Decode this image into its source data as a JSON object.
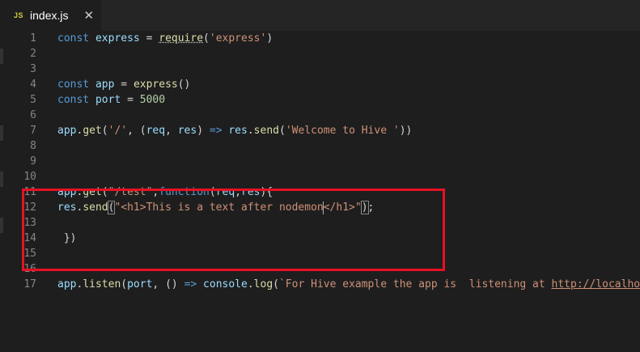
{
  "tab": {
    "icon_text": "JS",
    "filename": "index.js",
    "close_glyph": "✕"
  },
  "editor": {
    "lines": [
      {
        "number": "1",
        "tokens": [
          {
            "t": "const ",
            "c": "kw"
          },
          {
            "t": "express",
            "c": "var"
          },
          {
            "t": " = ",
            "c": ""
          },
          {
            "t": "require",
            "c": "fn squiggle"
          },
          {
            "t": "(",
            "c": ""
          },
          {
            "t": "'express'",
            "c": "str"
          },
          {
            "t": ")",
            "c": ""
          }
        ]
      },
      {
        "number": "2",
        "tokens": []
      },
      {
        "number": "3",
        "tokens": []
      },
      {
        "number": "4",
        "tokens": [
          {
            "t": "const ",
            "c": "kw"
          },
          {
            "t": "app",
            "c": "var"
          },
          {
            "t": " = ",
            "c": ""
          },
          {
            "t": "express",
            "c": "fn"
          },
          {
            "t": "()",
            "c": ""
          }
        ]
      },
      {
        "number": "5",
        "tokens": [
          {
            "t": "const ",
            "c": "kw"
          },
          {
            "t": "port",
            "c": "var"
          },
          {
            "t": " = ",
            "c": ""
          },
          {
            "t": "5000",
            "c": "num"
          }
        ]
      },
      {
        "number": "6",
        "tokens": []
      },
      {
        "number": "7",
        "tokens": [
          {
            "t": "app",
            "c": "var"
          },
          {
            "t": ".",
            "c": ""
          },
          {
            "t": "get",
            "c": "fn"
          },
          {
            "t": "(",
            "c": ""
          },
          {
            "t": "'/'",
            "c": "str"
          },
          {
            "t": ", (",
            "c": ""
          },
          {
            "t": "req",
            "c": "var"
          },
          {
            "t": ", ",
            "c": ""
          },
          {
            "t": "res",
            "c": "var"
          },
          {
            "t": ") ",
            "c": ""
          },
          {
            "t": "=>",
            "c": "kw"
          },
          {
            "t": " ",
            "c": ""
          },
          {
            "t": "res",
            "c": "var"
          },
          {
            "t": ".",
            "c": ""
          },
          {
            "t": "send",
            "c": "fn"
          },
          {
            "t": "(",
            "c": ""
          },
          {
            "t": "'Welcome to Hive '",
            "c": "str"
          },
          {
            "t": "))",
            "c": ""
          }
        ]
      },
      {
        "number": "8",
        "tokens": []
      },
      {
        "number": "9",
        "tokens": []
      },
      {
        "number": "10",
        "tokens": []
      },
      {
        "number": "11",
        "tokens": [
          {
            "t": "app",
            "c": "var"
          },
          {
            "t": ".",
            "c": ""
          },
          {
            "t": "get",
            "c": "fn"
          },
          {
            "t": "(",
            "c": ""
          },
          {
            "t": "\"/test\"",
            "c": "str"
          },
          {
            "t": ",",
            "c": ""
          },
          {
            "t": "function",
            "c": "kw"
          },
          {
            "t": "(",
            "c": ""
          },
          {
            "t": "req",
            "c": "var"
          },
          {
            "t": ",",
            "c": ""
          },
          {
            "t": "res",
            "c": "var"
          },
          {
            "t": "){",
            "c": ""
          }
        ]
      },
      {
        "number": "12",
        "tokens": [
          {
            "t": "res",
            "c": "var"
          },
          {
            "t": ".",
            "c": ""
          },
          {
            "t": "send",
            "c": "fn"
          },
          {
            "t": "(",
            "c": "bracket-match"
          },
          {
            "t": "\"<h1>This is a text after nodemon",
            "c": "str"
          },
          {
            "t": "",
            "c": "cursor"
          },
          {
            "t": "</h1>\"",
            "c": "str"
          },
          {
            "t": ")",
            "c": "bracket-match"
          },
          {
            "t": ";",
            "c": ""
          }
        ]
      },
      {
        "number": "13",
        "tokens": []
      },
      {
        "number": "14",
        "tokens": [
          {
            "t": " })",
            "c": ""
          }
        ]
      },
      {
        "number": "15",
        "tokens": []
      },
      {
        "number": "16",
        "tokens": []
      },
      {
        "number": "17",
        "tokens": [
          {
            "t": "app",
            "c": "var"
          },
          {
            "t": ".",
            "c": ""
          },
          {
            "t": "listen",
            "c": "fn"
          },
          {
            "t": "(",
            "c": ""
          },
          {
            "t": "port",
            "c": "var"
          },
          {
            "t": ", () ",
            "c": ""
          },
          {
            "t": "=>",
            "c": "kw"
          },
          {
            "t": " ",
            "c": ""
          },
          {
            "t": "console",
            "c": "var"
          },
          {
            "t": ".",
            "c": ""
          },
          {
            "t": "log",
            "c": "fn"
          },
          {
            "t": "(",
            "c": ""
          },
          {
            "t": "`For Hive example the app is  listening at ",
            "c": "str"
          },
          {
            "t": "http://localhost",
            "c": "url"
          }
        ]
      }
    ]
  },
  "colors": {
    "highlight_border": "#e81123",
    "editor_bg": "#1e1e1e"
  }
}
